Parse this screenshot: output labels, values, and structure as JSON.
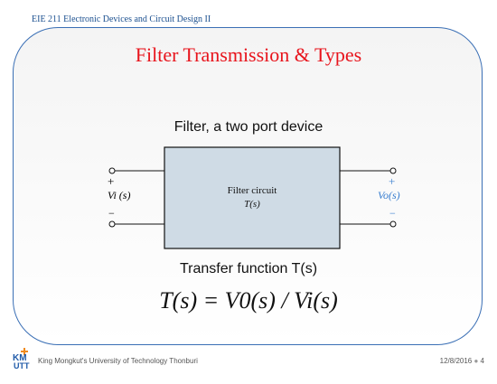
{
  "header": {
    "course": "EIE 211 Electronic Devices and Circuit Design II"
  },
  "slide": {
    "title": "Filter Transmission & Types",
    "subtitle": "Filter, a two port device",
    "transfer_label": "Transfer function T(s)",
    "equation": "T(s) = V0(s) / Vi(s)"
  },
  "diagram": {
    "block_line1": "Filter circuit",
    "block_line2": "T(s)",
    "input_plus": "+",
    "input_label": "Vi (s)",
    "input_minus": "−",
    "output_plus": "+",
    "output_label": "Vo(s)",
    "output_minus": "−"
  },
  "footer": {
    "university": "King Mongkut's University of Technology Thonburi",
    "date": "12/8/2016",
    "page": "4"
  },
  "colors": {
    "title": "#e8141c",
    "frame": "#3a6fb5",
    "block_fill": "#cfdbe5",
    "output_label": "#3a7fd0",
    "logo_blue": "#1f5aa8",
    "logo_orange": "#f08a1c"
  }
}
